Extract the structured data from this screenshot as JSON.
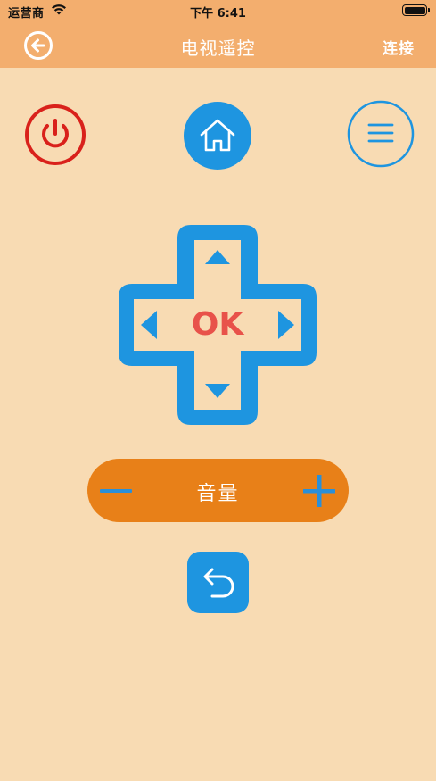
{
  "status_bar": {
    "carrier": "运营商",
    "time": "下午 6:41"
  },
  "nav": {
    "title": "电视遥控",
    "connect_label": "连接"
  },
  "dpad": {
    "ok_label": "OK"
  },
  "volume": {
    "label": "音量"
  },
  "colors": {
    "background": "#F8DBB3",
    "topbar": "#F3AE6E",
    "accent_blue": "#1E95E0",
    "power_red": "#D9211B",
    "volume_orange": "#E88018",
    "ok_red": "#E8524A"
  }
}
